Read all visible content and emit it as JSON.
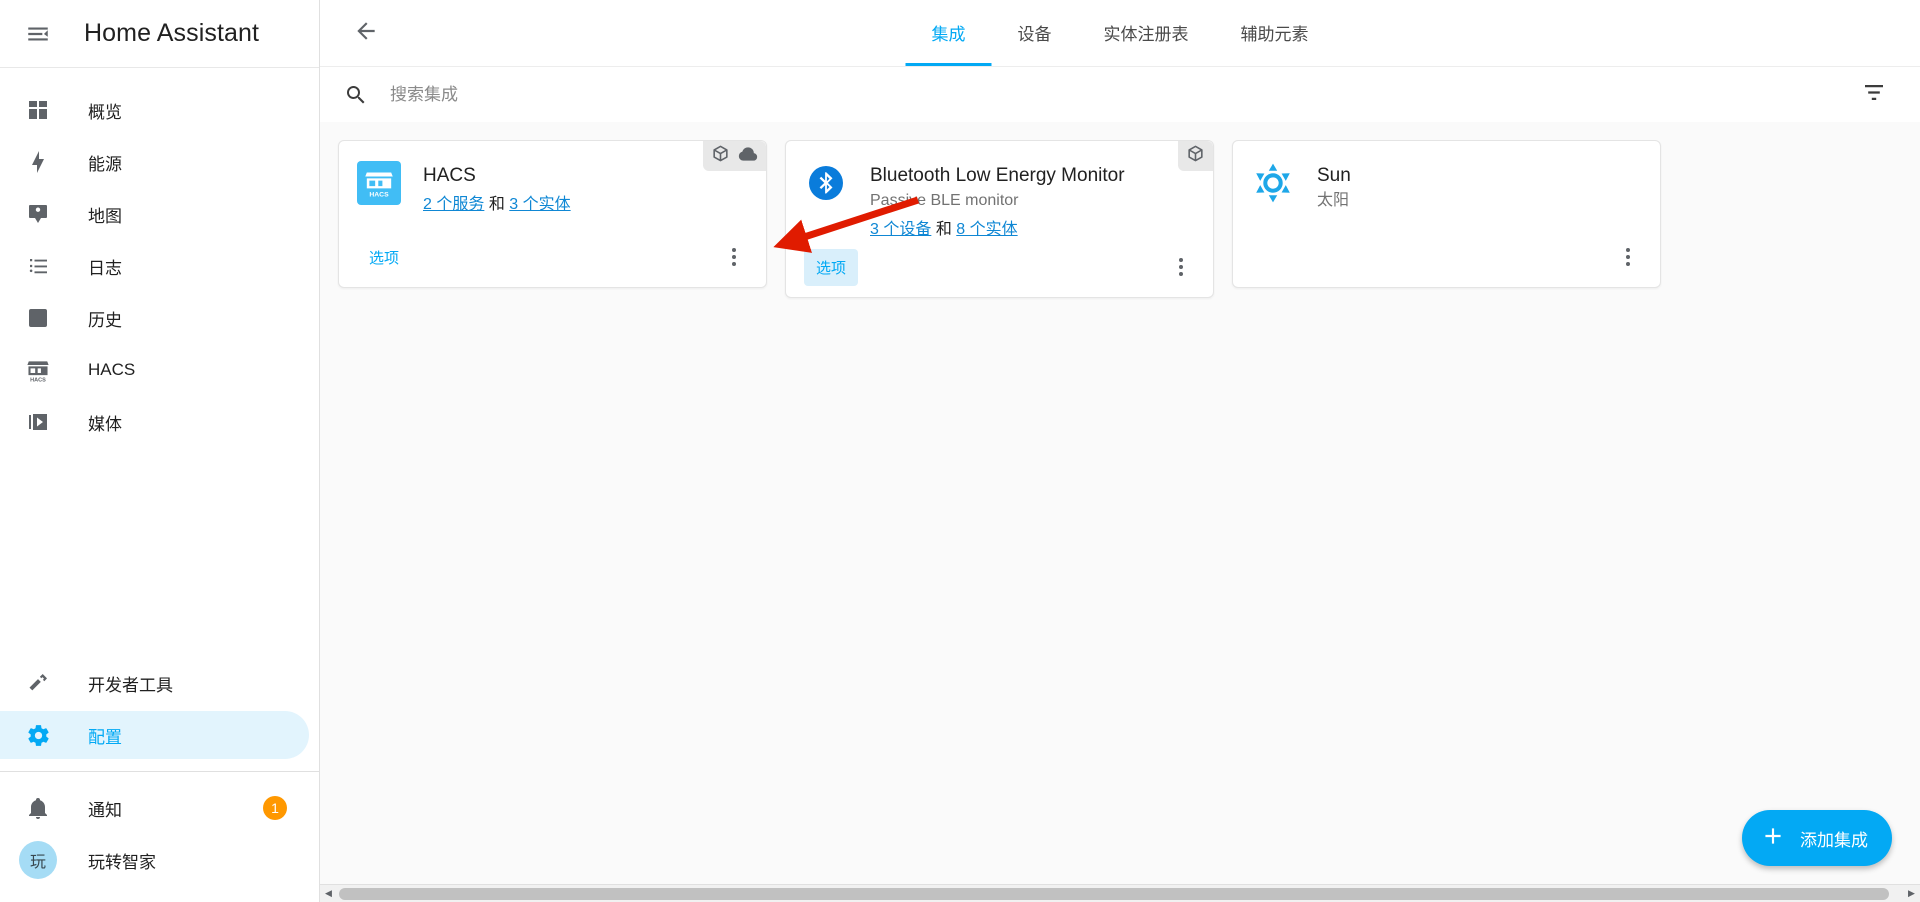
{
  "sidebar": {
    "title": "Home Assistant",
    "menu_icon": "menu-collapse-icon",
    "items": [
      {
        "label": "概览",
        "icon": "view-dashboard-icon",
        "active": false
      },
      {
        "label": "能源",
        "icon": "lightning-bolt-icon",
        "active": false
      },
      {
        "label": "地图",
        "icon": "account-map-marker-icon",
        "active": false
      },
      {
        "label": "日志",
        "icon": "format-list-bulleted-icon",
        "active": false
      },
      {
        "label": "历史",
        "icon": "chart-box-icon",
        "active": false
      },
      {
        "label": "HACS",
        "icon": "hacs-storefront-icon",
        "active": false
      },
      {
        "label": "媒体",
        "icon": "play-box-multiple-icon",
        "active": false
      }
    ],
    "bottom_items": [
      {
        "label": "开发者工具",
        "icon": "hammer-wrench-icon",
        "active": false
      },
      {
        "label": "配置",
        "icon": "gear-icon",
        "active": true
      }
    ],
    "notifications": {
      "label": "通知",
      "icon": "bell-icon",
      "badge": "1"
    },
    "user": {
      "label": "玩转智家",
      "avatar_initials": "玩"
    }
  },
  "toolbar": {
    "back_icon": "arrow-left-icon",
    "overflow_icon": "dots-vertical-icon",
    "tabs": [
      {
        "label": "集成",
        "active": true
      },
      {
        "label": "设备",
        "active": false
      },
      {
        "label": "实体注册表",
        "active": false
      },
      {
        "label": "辅助元素",
        "active": false
      }
    ]
  },
  "search": {
    "placeholder": "搜索集成",
    "value": "",
    "icon": "search-icon",
    "filter_icon": "filter-icon"
  },
  "integrations": [
    {
      "name": "HACS",
      "subtitle": "",
      "logo": "hacs-logo",
      "badges": [
        "cube-outline-icon",
        "cloud-icon"
      ],
      "links": [
        {
          "text": "2 个服务"
        },
        {
          "text": "3 个实体"
        }
      ],
      "link_separator": "和",
      "options_label": "选项",
      "options_focused": false,
      "menu_icon": "dots-vertical-icon"
    },
    {
      "name": "Bluetooth Low Energy Monitor",
      "subtitle": "Passive BLE monitor",
      "logo": "bluetooth-logo",
      "badges": [
        "cube-outline-icon"
      ],
      "links": [
        {
          "text": "3 个设备"
        },
        {
          "text": "8 个实体"
        }
      ],
      "link_separator": "和",
      "options_label": "选项",
      "options_focused": true,
      "menu_icon": "dots-vertical-icon"
    },
    {
      "name": "Sun",
      "subtitle": "太阳",
      "logo": "sun-logo",
      "badges": [],
      "links": [],
      "link_separator": "",
      "options_label": "",
      "options_focused": false,
      "menu_icon": "dots-vertical-icon"
    }
  ],
  "fab": {
    "label": "添加集成",
    "icon": "plus-icon"
  },
  "colors": {
    "accent": "#03a9f4",
    "link": "#0f87d4",
    "badge": "#ff9800",
    "active_bg": "#e2f4fd",
    "arrow_annotation": "#e01b00"
  }
}
